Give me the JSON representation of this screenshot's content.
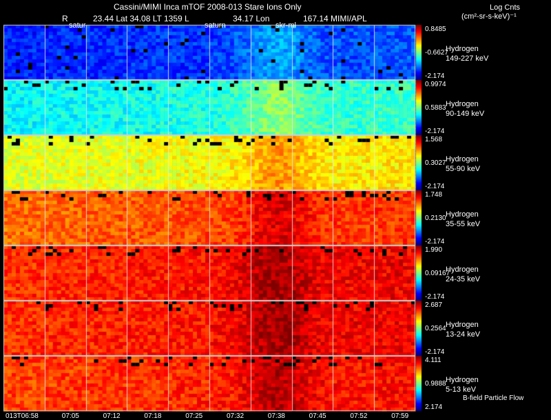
{
  "header": {
    "title": "Cassini/MIMI Inca mTOF  2008-013   Stare   Ions Only",
    "row2_R": "R",
    "row2_lat": "23.44 Lat 34.08 LT 1359 L",
    "row2_lon": "34.17 Lon",
    "row2_mimi": "167.14  MIMI/APL",
    "overlay_left": "satur",
    "overlay_mid": "saturn",
    "overlay_right": "skr-ml",
    "colorbar_title_1": "Log Cnts",
    "colorbar_title_2": "(cm²-sr-s-keV)⁻¹",
    "footer_note": "B-field Particle Flow"
  },
  "chart_data": {
    "type": "heatmap",
    "x_tick_labels": [
      "013T06:58",
      "07:05",
      "07:12",
      "07:18",
      "07:25",
      "07:32",
      "07:38",
      "07:45",
      "07:52",
      "07:59"
    ],
    "panels": [
      {
        "species": "Hydrogen",
        "energy": "149-227 keV",
        "cb_max": "0.8485",
        "cb_mid": "-0.6627",
        "cb_min": "-2.174",
        "level": 0.18
      },
      {
        "species": "Hydrogen",
        "energy": "90-149 keV",
        "cb_max": "0.9974",
        "cb_mid": "0.5883",
        "cb_min": "-2.174",
        "level": 0.4
      },
      {
        "species": "Hydrogen",
        "energy": "55-90 keV",
        "cb_max": "1.568",
        "cb_mid": "0.3027",
        "cb_min": "-2.174",
        "level": 0.62
      },
      {
        "species": "Hydrogen",
        "energy": "35-55 keV",
        "cb_max": "1.748",
        "cb_mid": "0.2130",
        "cb_min": "-2.174",
        "level": 0.8
      },
      {
        "species": "Hydrogen",
        "energy": "24-35 keV",
        "cb_max": "1.990",
        "cb_mid": "0.09167",
        "cb_min": "-2.174",
        "level": 0.86
      },
      {
        "species": "Hydrogen",
        "energy": "13-24 keV",
        "cb_max": "2.687",
        "cb_mid": "0.2564",
        "cb_min": "-2.174",
        "level": 0.86
      },
      {
        "species": "Hydrogen",
        "energy": "5-13 keV",
        "cb_max": "4.111",
        "cb_mid": "0.9888",
        "cb_min": "2.174",
        "level": 0.84
      }
    ]
  }
}
